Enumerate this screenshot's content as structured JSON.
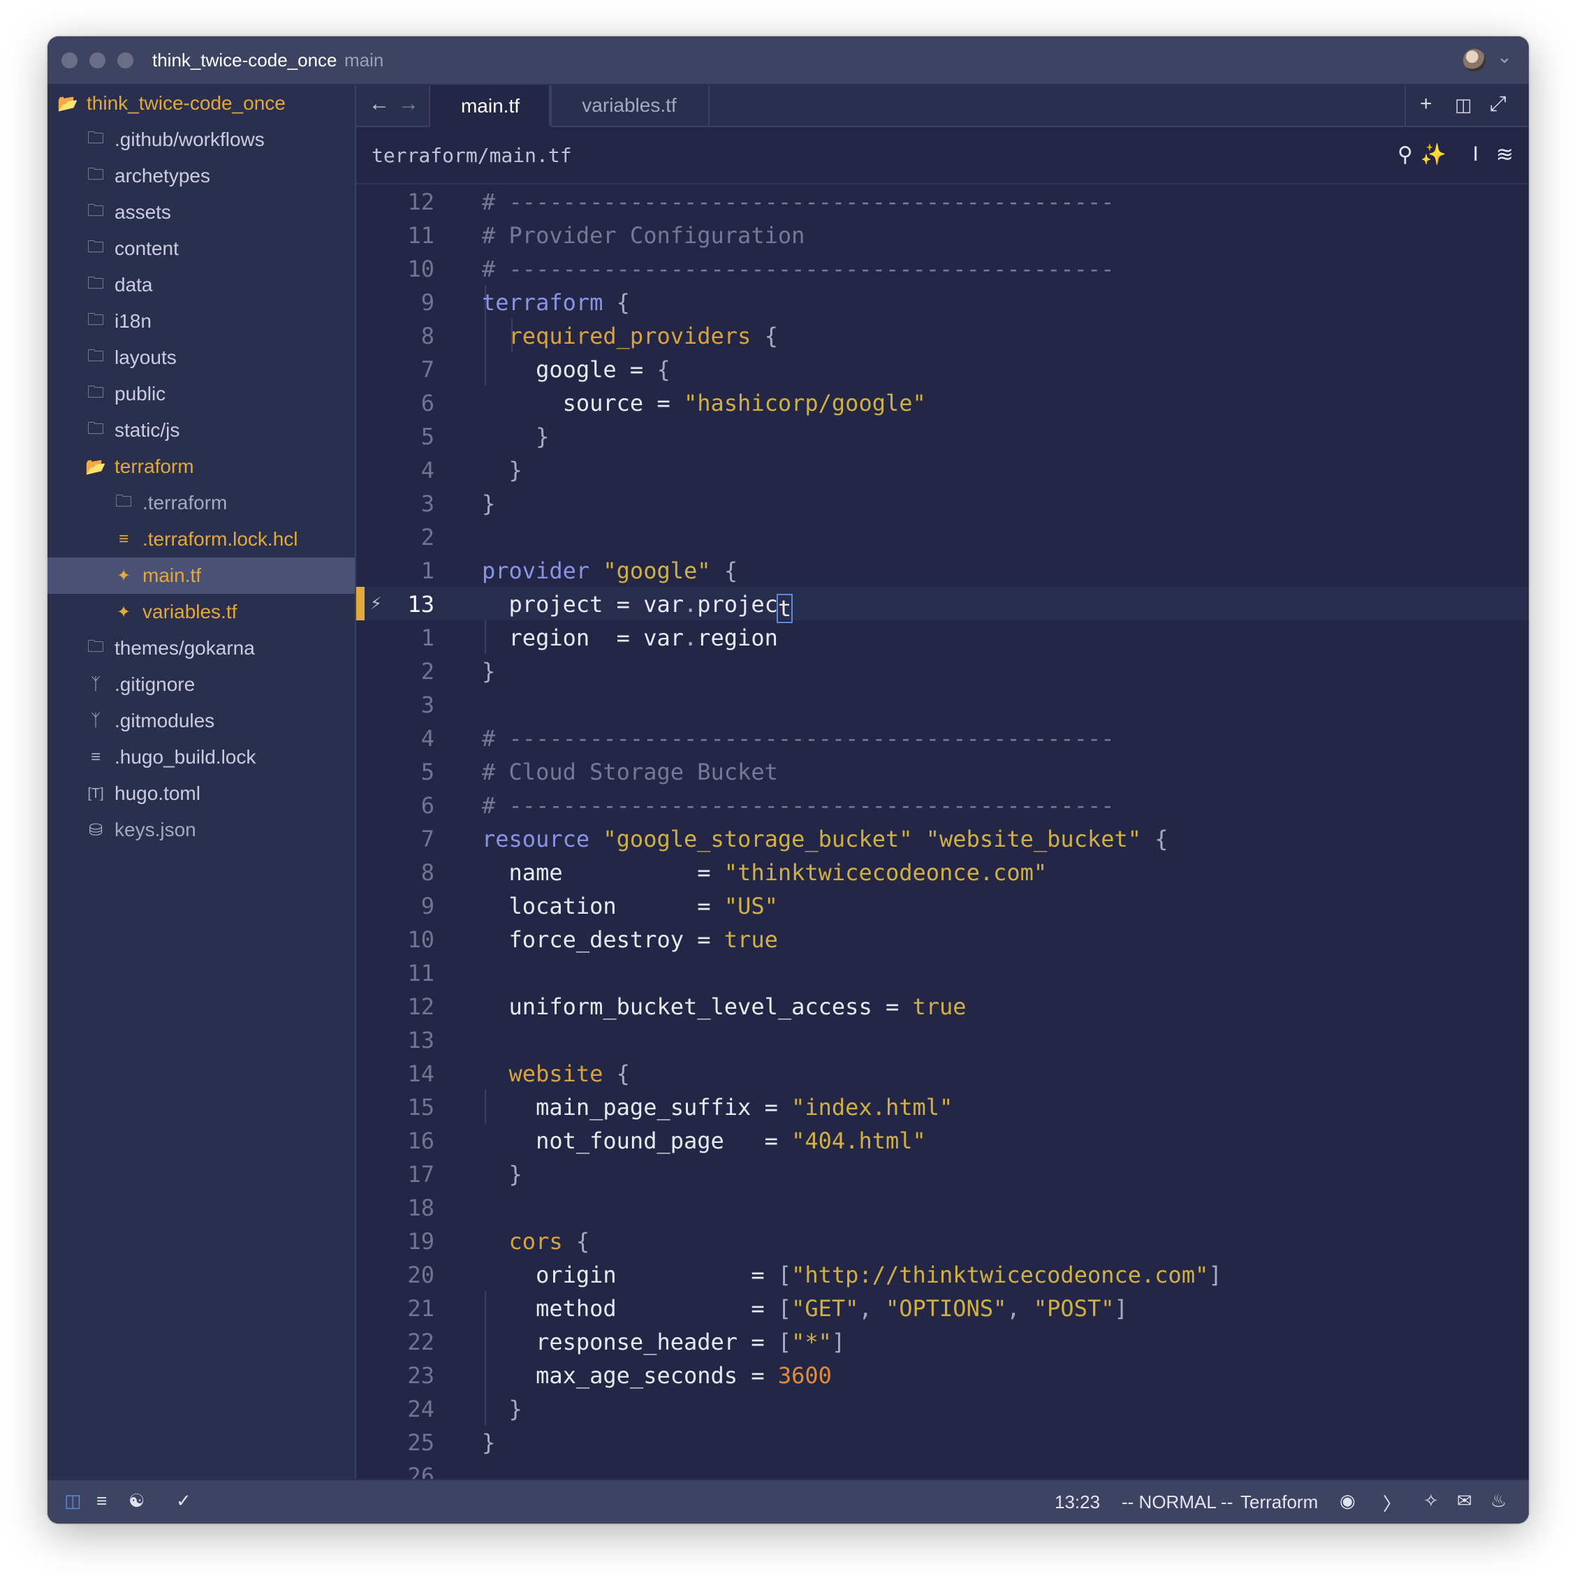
{
  "window": {
    "title": "think_twice-code_once",
    "branch": "main"
  },
  "sidebar": {
    "root": "think_twice-code_once",
    "items": [
      {
        "label": ".github/workflows",
        "icon": "folder-icon"
      },
      {
        "label": "archetypes",
        "icon": "folder-icon"
      },
      {
        "label": "assets",
        "icon": "folder-icon"
      },
      {
        "label": "content",
        "icon": "folder-icon"
      },
      {
        "label": "data",
        "icon": "folder-icon"
      },
      {
        "label": "i18n",
        "icon": "folder-icon"
      },
      {
        "label": "layouts",
        "icon": "folder-icon"
      },
      {
        "label": "public",
        "icon": "folder-icon"
      },
      {
        "label": "static/js",
        "icon": "folder-icon"
      },
      {
        "label": "terraform",
        "icon": "folder-open-icon"
      },
      {
        "label": ".terraform",
        "icon": "folder-icon"
      },
      {
        "label": ".terraform.lock.hcl",
        "icon": "lines-icon"
      },
      {
        "label": "main.tf",
        "icon": "terraform-icon"
      },
      {
        "label": "variables.tf",
        "icon": "terraform-icon"
      },
      {
        "label": "themes/gokarna",
        "icon": "folder-icon"
      },
      {
        "label": ".gitignore",
        "icon": "git-icon"
      },
      {
        "label": ".gitmodules",
        "icon": "git-icon"
      },
      {
        "label": ".hugo_build.lock",
        "icon": "lines-icon"
      },
      {
        "label": "hugo.toml",
        "icon": "toml-icon"
      },
      {
        "label": "keys.json",
        "icon": "database-icon"
      }
    ]
  },
  "tabs": [
    {
      "label": "main.tf",
      "active": true
    },
    {
      "label": "variables.tf",
      "active": false
    }
  ],
  "breadcrumb": "terraform/main.tf",
  "editor": {
    "line_numbers": [
      "12",
      "11",
      "10",
      "9",
      "8",
      "7",
      "6",
      "5",
      "4",
      "3",
      "2",
      "1",
      "13",
      "1",
      "2",
      "3",
      "4",
      "5",
      "6",
      "7",
      "8",
      "9",
      "10",
      "11",
      "12",
      "13",
      "14",
      "15",
      "16",
      "17",
      "18",
      "19",
      "20",
      "21",
      "22",
      "23",
      "24",
      "25",
      "26"
    ],
    "current_line": "13"
  },
  "status": {
    "position": "13:23",
    "mode": "-- NORMAL --",
    "language": "Terraform"
  },
  "colors": {
    "background": "#232745",
    "sidebar": "#2b2f4e",
    "accent_yellow": "#e0a93a",
    "keyword": "#8a93e6",
    "string": "#d0b046",
    "number": "#e08c3d",
    "comment": "#737996"
  }
}
